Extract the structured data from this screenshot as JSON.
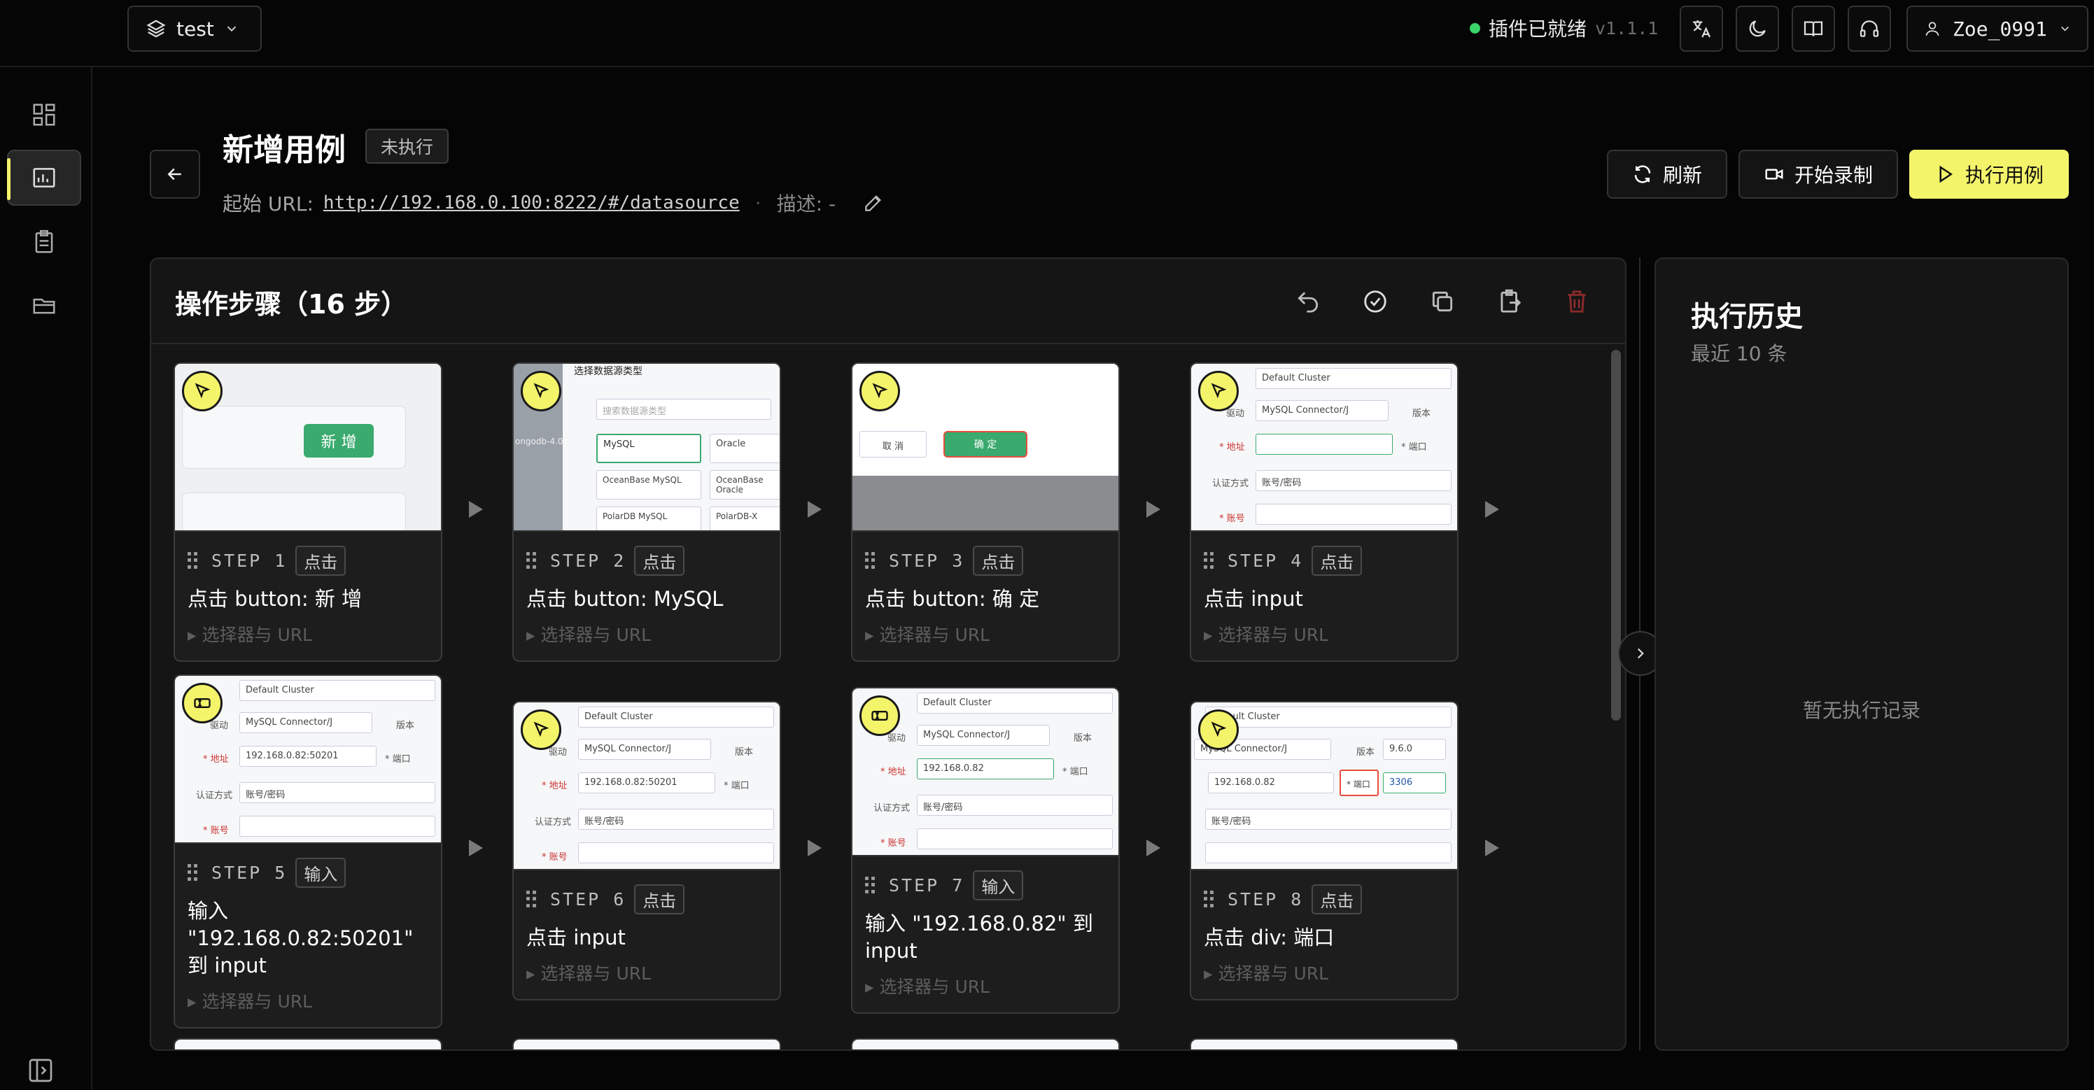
{
  "project": {
    "name": "test"
  },
  "status": {
    "text": "插件已就绪",
    "version": "v1.1.1"
  },
  "user": {
    "name": "Zoe_0991"
  },
  "page": {
    "title": "新增用例",
    "state_badge": "未执行",
    "url_label": "起始 URL:",
    "url": "http://192.168.0.100:8222/#/datasource",
    "separator": "·",
    "desc": "描述: -"
  },
  "actions": {
    "refresh": "刷新",
    "record": "开始录制",
    "run": "执行用例"
  },
  "steps_panel": {
    "title": "操作步骤（16 步）",
    "selector_label": "▸ 选择器与 URL"
  },
  "steps": [
    {
      "num": "STEP 1",
      "type": "点击",
      "action": "点击 button: 新 增"
    },
    {
      "num": "STEP 2",
      "type": "点击",
      "action": "点击 button: MySQL"
    },
    {
      "num": "STEP 3",
      "type": "点击",
      "action": "点击 button: 确 定"
    },
    {
      "num": "STEP 4",
      "type": "点击",
      "action": "点击 input"
    },
    {
      "num": "STEP 5",
      "type": "输入",
      "action": "输入 \"192.168.0.82:50201\" 到 input"
    },
    {
      "num": "STEP 6",
      "type": "点击",
      "action": "点击 input"
    },
    {
      "num": "STEP 7",
      "type": "输入",
      "action": "输入 \"192.168.0.82\" 到 input"
    },
    {
      "num": "STEP 8",
      "type": "点击",
      "action": "点击 div: 端口"
    }
  ],
  "thumbs": {
    "add_btn": "新 增",
    "choose_ds": "选择数据源类型",
    "search_ds": "搜索数据源类型",
    "mongo": "ongodb-4.0",
    "mysql": "MySQL",
    "oracle": "Oracle",
    "oceanbase_mysql": "OceanBase MySQL",
    "oceanbase_oracle": "OceanBase Oracle",
    "polardb": "PolarDB MySQL",
    "polardb_x": "PolarDB-X",
    "cancel": "取 消",
    "confirm": "确 定",
    "cluster": "Default Cluster",
    "driver_label": "驱动",
    "driver": "MySQL Connector/J",
    "version_label": "版本",
    "version": "9.6.0",
    "addr_label": "* 地址",
    "port_label": "* 端口",
    "auth_label": "认证方式",
    "auth": "账号/密码",
    "account_label": "* 账号",
    "ip_port": "192.168.0.82:50201",
    "ip": "192.168.0.82",
    "port": "3306"
  },
  "history": {
    "title": "执行历史",
    "subtitle": "最近 10 条",
    "empty": "暂无执行记录"
  },
  "colors": {
    "accent": "#f4f46b",
    "ready": "#3ad46a",
    "danger": "#c0392b"
  }
}
